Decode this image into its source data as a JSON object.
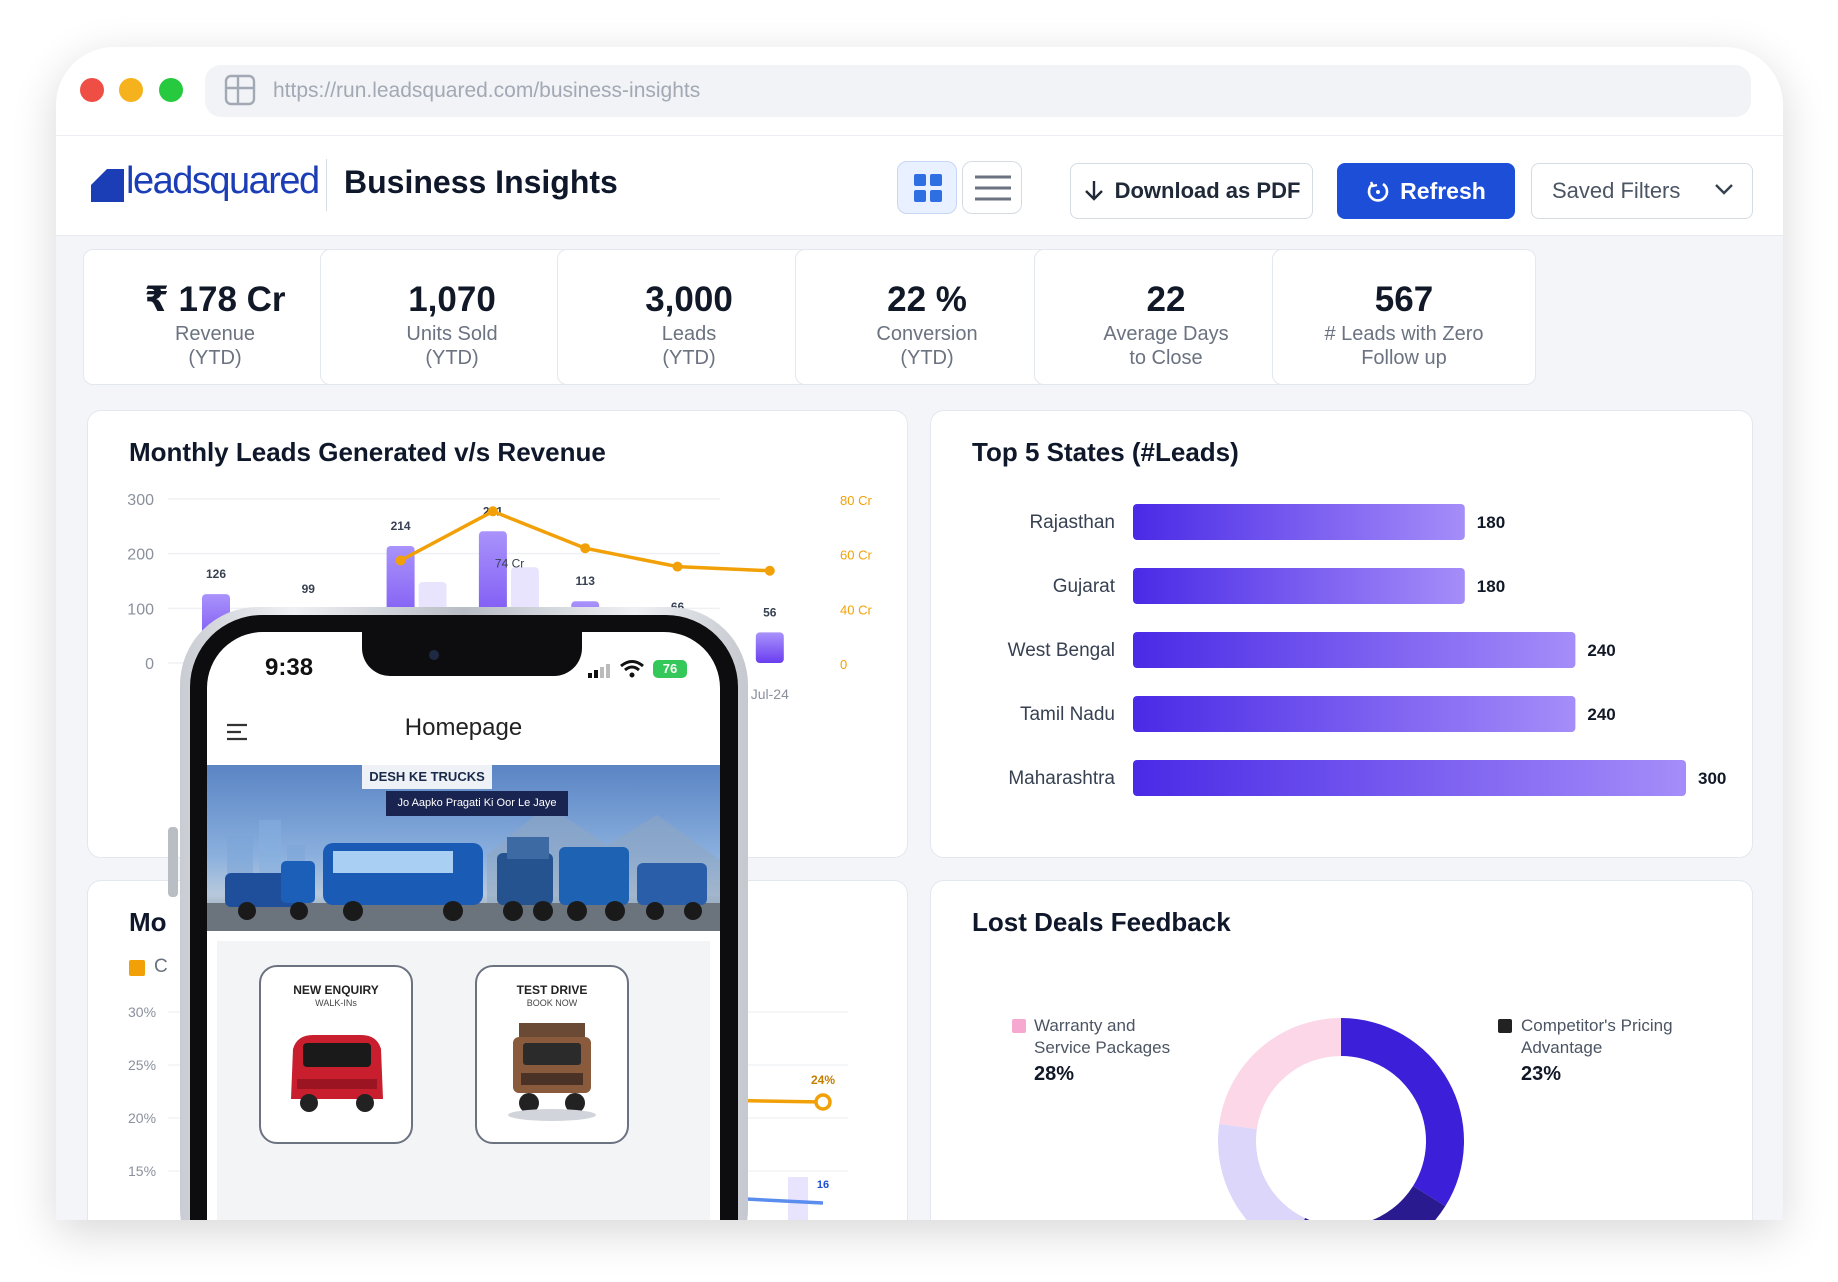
{
  "browser": {
    "url": "https://run.leadsquared.com/business-insights"
  },
  "header": {
    "logo_text": "leadsquared",
    "title": "Business Insights",
    "download_label": "Download as PDF",
    "refresh_label": "Refresh",
    "filters_label": "Saved Filters"
  },
  "kpis": [
    {
      "value": "₹ 178 Cr",
      "label1": "Revenue",
      "label2": "(YTD)"
    },
    {
      "value": "1,070",
      "label1": "Units Sold",
      "label2": "(YTD)"
    },
    {
      "value": "3,000",
      "label1": "Leads",
      "label2": "(YTD)"
    },
    {
      "value": "22 %",
      "label1": "Conversion",
      "label2": "(YTD)"
    },
    {
      "value": "22",
      "label1": "Average Days",
      "label2": "to Close"
    },
    {
      "value": "567",
      "label1": "# Leads with Zero",
      "label2": "Follow up"
    }
  ],
  "colors": {
    "accent": "#1d4ed8",
    "bar": "#7c5cf5",
    "line": "#f2a007",
    "donut_dark": "#3b1fd9"
  },
  "monthly_chart": {
    "title": "Monthly Leads Generated v/s Revenue",
    "chart_data": {
      "type": "bar",
      "left_axis_ticks": [
        "300",
        "200",
        "100",
        "0"
      ],
      "right_axis_ticks": [
        "80 Cr",
        "60 Cr",
        "40 Cr",
        "0"
      ],
      "ylim": [
        0,
        300
      ],
      "bar_labels": [
        "126",
        "99",
        "214",
        "241",
        "113",
        "66",
        "56"
      ],
      "leads": [
        126,
        99,
        214,
        241,
        113,
        66,
        56
      ],
      "revenue_cr": [
        null,
        null,
        50,
        74,
        56,
        47,
        45
      ],
      "revenue_label": "74 Cr",
      "last_x_label": "Jul-24"
    }
  },
  "states_chart": {
    "title": "Top 5 States (#Leads)",
    "chart_data": {
      "type": "bar",
      "orientation": "horizontal",
      "categories": [
        "Rajasthan",
        "Gujarat",
        "West Bengal",
        "Tamil Nadu",
        "Maharashtra"
      ],
      "values": [
        180,
        180,
        240,
        240,
        300
      ],
      "labels": [
        "180",
        "180",
        "240",
        "240",
        "300"
      ],
      "xlim": [
        0,
        300
      ]
    }
  },
  "mo_card": {
    "title_partial": "Mo",
    "legend_partial": "C",
    "ticks": [
      "30%",
      "25%",
      "20%",
      "15%"
    ],
    "label_24": "24%",
    "label_16": "16"
  },
  "lost_deals": {
    "title": "Lost Deals Feedback",
    "chart_data": {
      "type": "pie",
      "visible_labels": [
        {
          "name_line1": "Warranty and",
          "name_line2": "Service Packages",
          "pct": "28%",
          "color": "#f7a8d0"
        },
        {
          "name_line1": "Competitor's Pricing",
          "name_line2": "Advantage",
          "pct": "23%",
          "color": "#222222"
        }
      ]
    }
  },
  "phone": {
    "time": "9:38",
    "battery": "76",
    "screen_title": "Homepage",
    "banner_tag": "DESH KE TRUCKS",
    "banner_sub": "Jo Aapko Pragati Ki Oor Le Jaye",
    "tiles": [
      {
        "title": "NEW ENQUIRY",
        "subtitle": "WALK-INs"
      },
      {
        "title": "TEST DRIVE",
        "subtitle": "BOOK NOW"
      }
    ]
  }
}
